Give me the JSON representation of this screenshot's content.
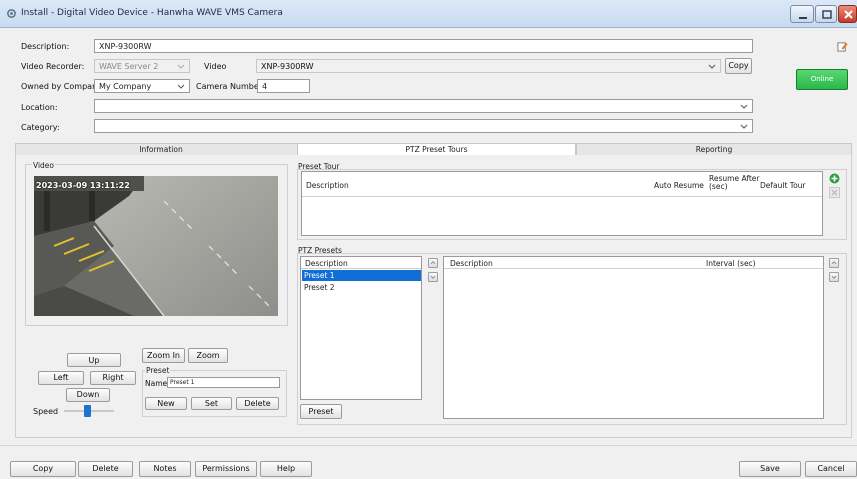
{
  "window": {
    "title": "Install - Digital Video Device - Hanwha WAVE VMS Camera",
    "icons": {
      "app": "gear-icon",
      "minimize": "minimize-icon",
      "maximize": "maximize-icon",
      "close": "close-icon"
    }
  },
  "form": {
    "description_label": "Description:",
    "description_value": "XNP-9300RW",
    "recorder_label": "Video Recorder:",
    "recorder_value": "WAVE Server 2",
    "video_label": "Video",
    "video_value": "XNP-9300RW",
    "copy_label": "Copy",
    "owned_label": "Owned by Company:",
    "owned_value": "My Company",
    "camera_number_label": "Camera Number:",
    "camera_number_value": "4",
    "location_label": "Location:",
    "location_value": "",
    "category_label": "Category:",
    "category_value": "",
    "online_label": "Online",
    "online_color": "#2cb84b"
  },
  "tabs": [
    {
      "label": "Information",
      "active": false
    },
    {
      "label": "PTZ Preset Tours",
      "active": true
    },
    {
      "label": "Reporting",
      "active": false
    }
  ],
  "video_panel": {
    "title": "Video",
    "timestamp": "2023-03-09 13:11:22"
  },
  "ptz_controls": {
    "up": "Up",
    "left": "Left",
    "right": "Right",
    "down": "Down",
    "zoom_in": "Zoom In",
    "zoom_out": "Zoom",
    "speed_label": "Speed",
    "speed_level": 0.45,
    "preset_group": "Preset",
    "name_label": "Name",
    "name_value": "Preset 1",
    "new": "New",
    "set": "Set",
    "delete": "Delete"
  },
  "preset_tour": {
    "title": "Preset Tour",
    "columns": [
      "Description",
      "Auto Resume",
      "Resume After (sec)",
      "Default Tour"
    ]
  },
  "ptz_presets": {
    "title": "PTZ Presets",
    "list_header": "Description",
    "items": [
      "Preset 1",
      "Preset 2"
    ],
    "selected_index": 0,
    "detail_columns": [
      "Description",
      "Interval (sec)"
    ],
    "preset_button": "Preset"
  },
  "footer": {
    "copy": "Copy",
    "delete": "Delete",
    "notes": "Notes",
    "permissions": "Permissions",
    "help": "Help",
    "save": "Save",
    "cancel": "Cancel"
  }
}
